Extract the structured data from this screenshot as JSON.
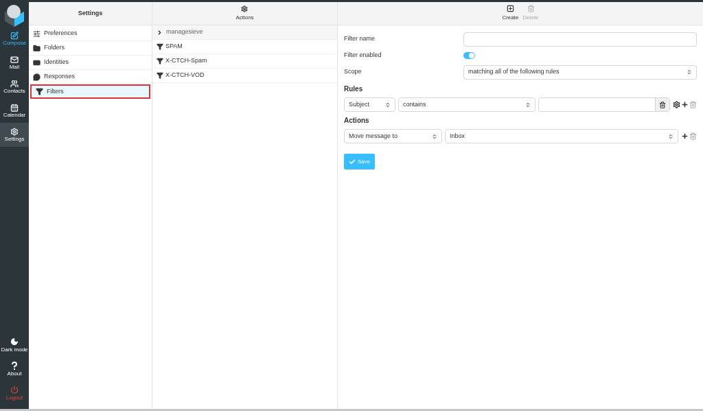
{
  "nav": [
    {
      "kind": "compose",
      "label": "Compose",
      "selected": false
    },
    {
      "kind": "mail",
      "label": "Mail",
      "selected": false
    },
    {
      "kind": "contacts",
      "label": "Contacts",
      "selected": false
    },
    {
      "kind": "calendar",
      "label": "Calendar",
      "selected": false
    },
    {
      "kind": "settings",
      "label": "Settings",
      "selected": true
    }
  ],
  "nav_bottom": [
    {
      "kind": "dark",
      "label": "Dark mode"
    },
    {
      "kind": "about",
      "label": "About"
    },
    {
      "kind": "logout",
      "label": "Logout"
    }
  ],
  "settings": {
    "title": "Settings",
    "items": [
      {
        "kind": "preferences",
        "label": "Preferences",
        "selected": false
      },
      {
        "kind": "folders",
        "label": "Folders",
        "selected": false
      },
      {
        "kind": "identities",
        "label": "Identities",
        "selected": false
      },
      {
        "kind": "responses",
        "label": "Responses",
        "selected": false
      },
      {
        "kind": "filters",
        "label": "Filters",
        "selected": true
      }
    ]
  },
  "filter_sets": {
    "action": "Actions",
    "group": "managesieve",
    "items": [
      {
        "label": "SPAM"
      },
      {
        "label": "X-CTCH-Spam"
      },
      {
        "label": "X-CTCH-VOD"
      }
    ]
  },
  "toolbar": [
    {
      "kind": "create",
      "label": "Create",
      "disabled": false
    },
    {
      "kind": "delete",
      "label": "Delete",
      "disabled": true
    }
  ],
  "form": {
    "name_label": "Filter name",
    "enabled_label": "Filter enabled",
    "enabled": true,
    "scope_label": "Scope",
    "scope": "matching all of the following rules",
    "rules_title": "Rules",
    "rule": {
      "header": "Subject",
      "op": "contains"
    },
    "actions_title": "Actions",
    "action": {
      "type": "Move message to",
      "target": "Inbox"
    },
    "save": "Save"
  }
}
